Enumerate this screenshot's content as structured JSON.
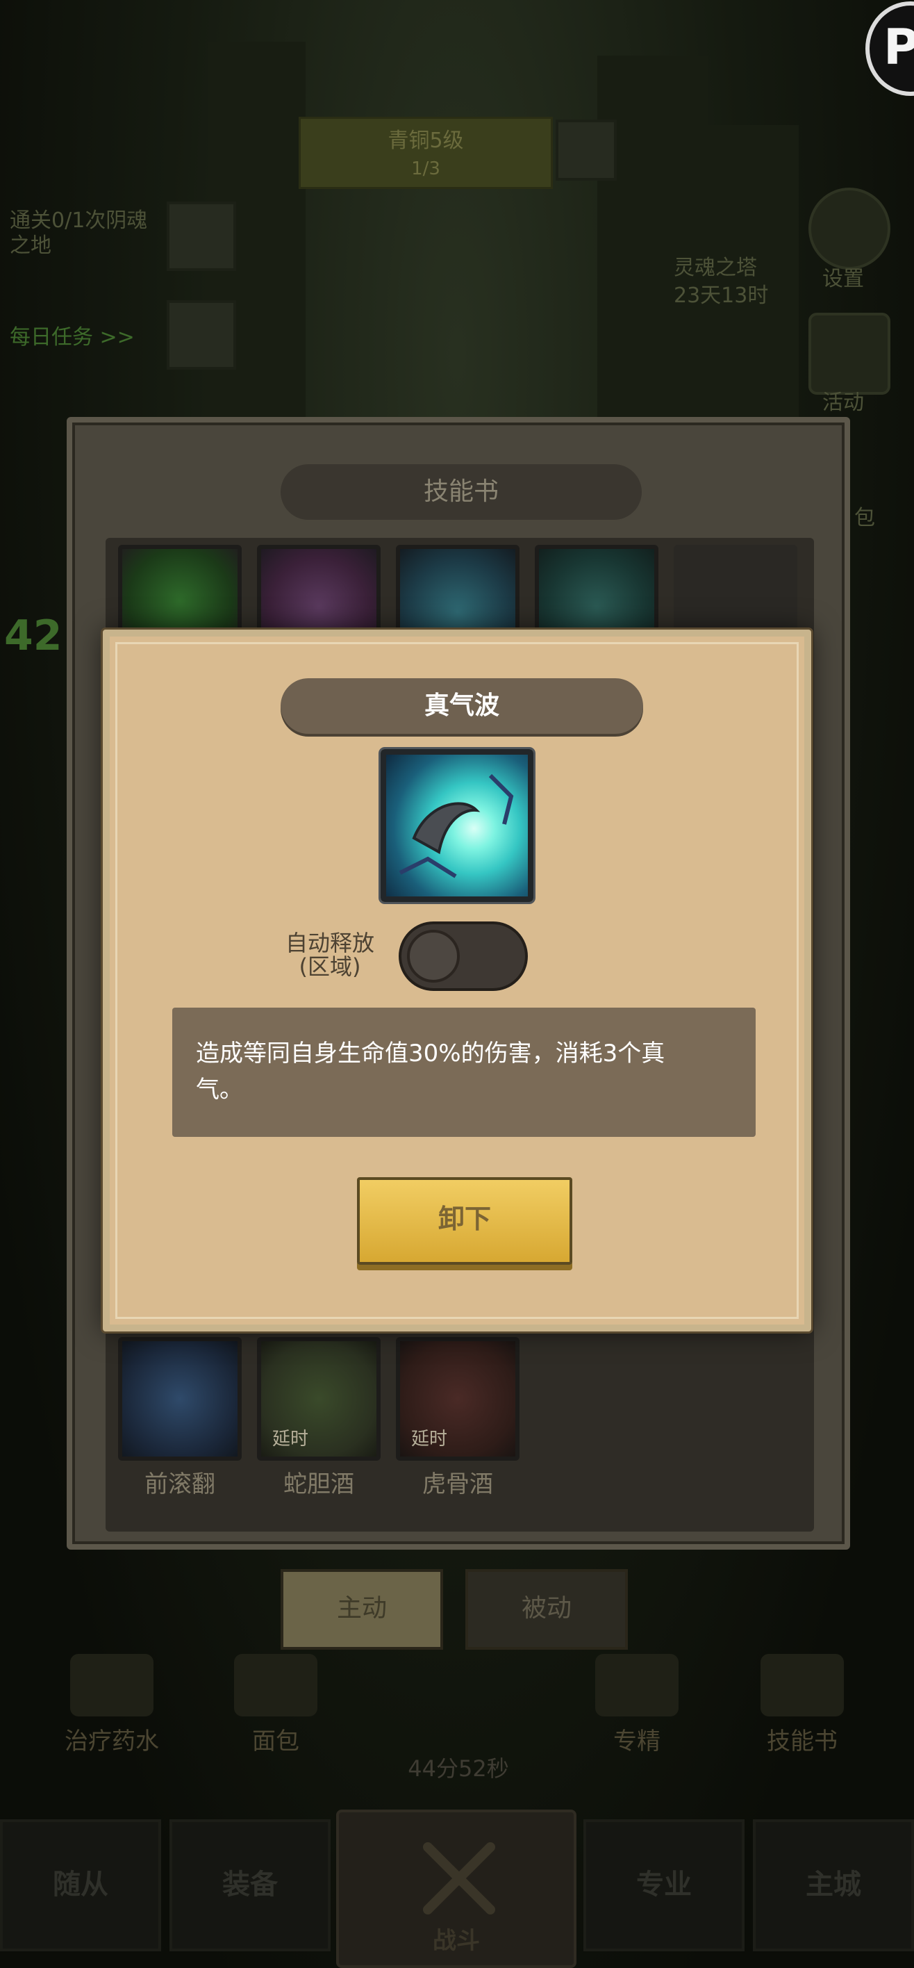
{
  "background": {
    "level_title": "青铜5级",
    "level_sub": "1/3",
    "quest_text": "通关0/1次阴魂之地",
    "daily_text": "每日任务 >>",
    "event_title": "灵魂之塔",
    "event_time": "23天13时",
    "settings_label": "设置",
    "activity_label": "活动",
    "bag_label": "包",
    "left_number": "42"
  },
  "skillbook": {
    "title": "技能书",
    "top_slots": [
      "green-vortex",
      "purple-claw",
      "cyan-wave",
      "star-shield"
    ],
    "bottom_slots": [
      {
        "label": "前滚翻",
        "delay": ""
      },
      {
        "label": "蛇胆酒",
        "delay": "延时"
      },
      {
        "label": "虎骨酒",
        "delay": "延时"
      }
    ],
    "tabs": {
      "active": "主动",
      "passive": "被动"
    }
  },
  "tools": [
    {
      "label": "治疗药水"
    },
    {
      "label": "面包"
    },
    {
      "label": "专精"
    },
    {
      "label": "技能书"
    }
  ],
  "timer": "44分52秒",
  "nav": {
    "follower": "随从",
    "equipment": "装备",
    "battle": "战斗",
    "mastery": "专业",
    "main_city": "主城"
  },
  "corner_badge": "P",
  "modal": {
    "title": "真气波",
    "auto_release_label": "自动释放",
    "auto_release_sub": "(区域)",
    "auto_release_on": false,
    "description_line1": "造成等同自身生命值30%的伤害，消耗3个真",
    "description_line2": "气。",
    "unload_label": "卸下"
  }
}
